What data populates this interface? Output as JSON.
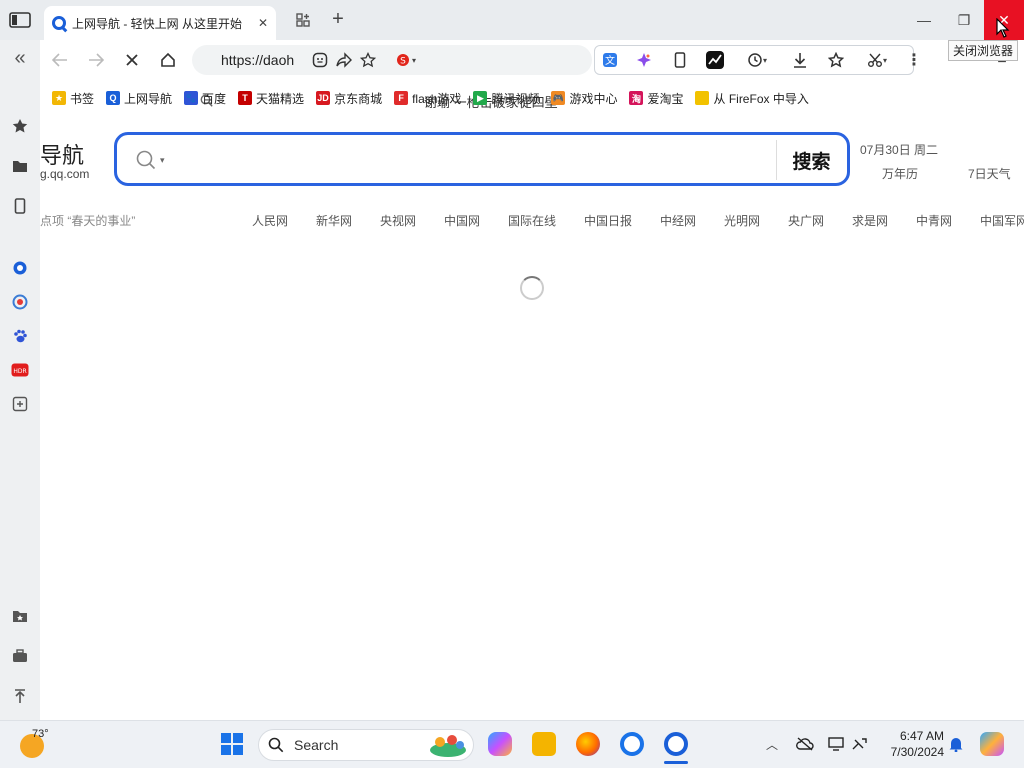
{
  "tab": {
    "title": "上网导航 - 轻快上网 从这里开始",
    "close": "✕"
  },
  "new_tab": "+",
  "window": {
    "minimize": "—",
    "restore": "❐",
    "close": "✕",
    "close_tooltip": "关闭浏览器"
  },
  "address": {
    "url": "https://daoh",
    "search_hint": "谢瑜 一枪击破家徒四壁"
  },
  "bookmarks": [
    {
      "label": "书签",
      "icon": "star-icon",
      "color": "#f2b705",
      "glyph": "★"
    },
    {
      "label": "上网导航",
      "icon": "qq-nav-icon",
      "color": "#1a5fd8",
      "glyph": "Q"
    },
    {
      "label": "百度",
      "icon": "baidu-paw-icon",
      "color": "#2f54d6",
      "glyph": "🐾"
    },
    {
      "label": "天猫精选",
      "icon": "tmall-icon",
      "color": "#c40000",
      "glyph": "T"
    },
    {
      "label": "京东商城",
      "icon": "jd-icon",
      "color": "#d71920",
      "glyph": "JD"
    },
    {
      "label": "flash游戏",
      "icon": "flash-game-icon",
      "color": "#e02b2b",
      "glyph": "F"
    },
    {
      "label": "腾讯视频",
      "icon": "tencent-video-icon",
      "color": "#22a94b",
      "glyph": "▶"
    },
    {
      "label": "游戏中心",
      "icon": "game-center-icon",
      "color": "#f08a24",
      "glyph": "🎮"
    },
    {
      "label": "爱淘宝",
      "icon": "taobao-icon",
      "color": "#d4145a",
      "glyph": "淘"
    },
    {
      "label": "从 FireFox 中导入",
      "icon": "folder-icon",
      "color": "#f2c200",
      "glyph": ""
    }
  ],
  "page": {
    "logo_title": "导航",
    "logo_domain": "g.qq.com",
    "search_button": "搜索",
    "date": "07月30日 周二",
    "calendar_link": "万年历",
    "weather_link": "7日天气",
    "left_text": "点项 “春天的事业”",
    "news_links": [
      "人民网",
      "新华网",
      "央视网",
      "中国网",
      "国际在线",
      "中国日报",
      "中经网",
      "光明网",
      "央广网",
      "求是网",
      "中青网",
      "中国军网"
    ]
  },
  "taskbar": {
    "temperature": "73°",
    "search_placeholder": "Search",
    "time": "6:47 AM",
    "date": "7/30/2024"
  },
  "colors": {
    "accent": "#2a63e0",
    "close_red": "#e81123"
  }
}
